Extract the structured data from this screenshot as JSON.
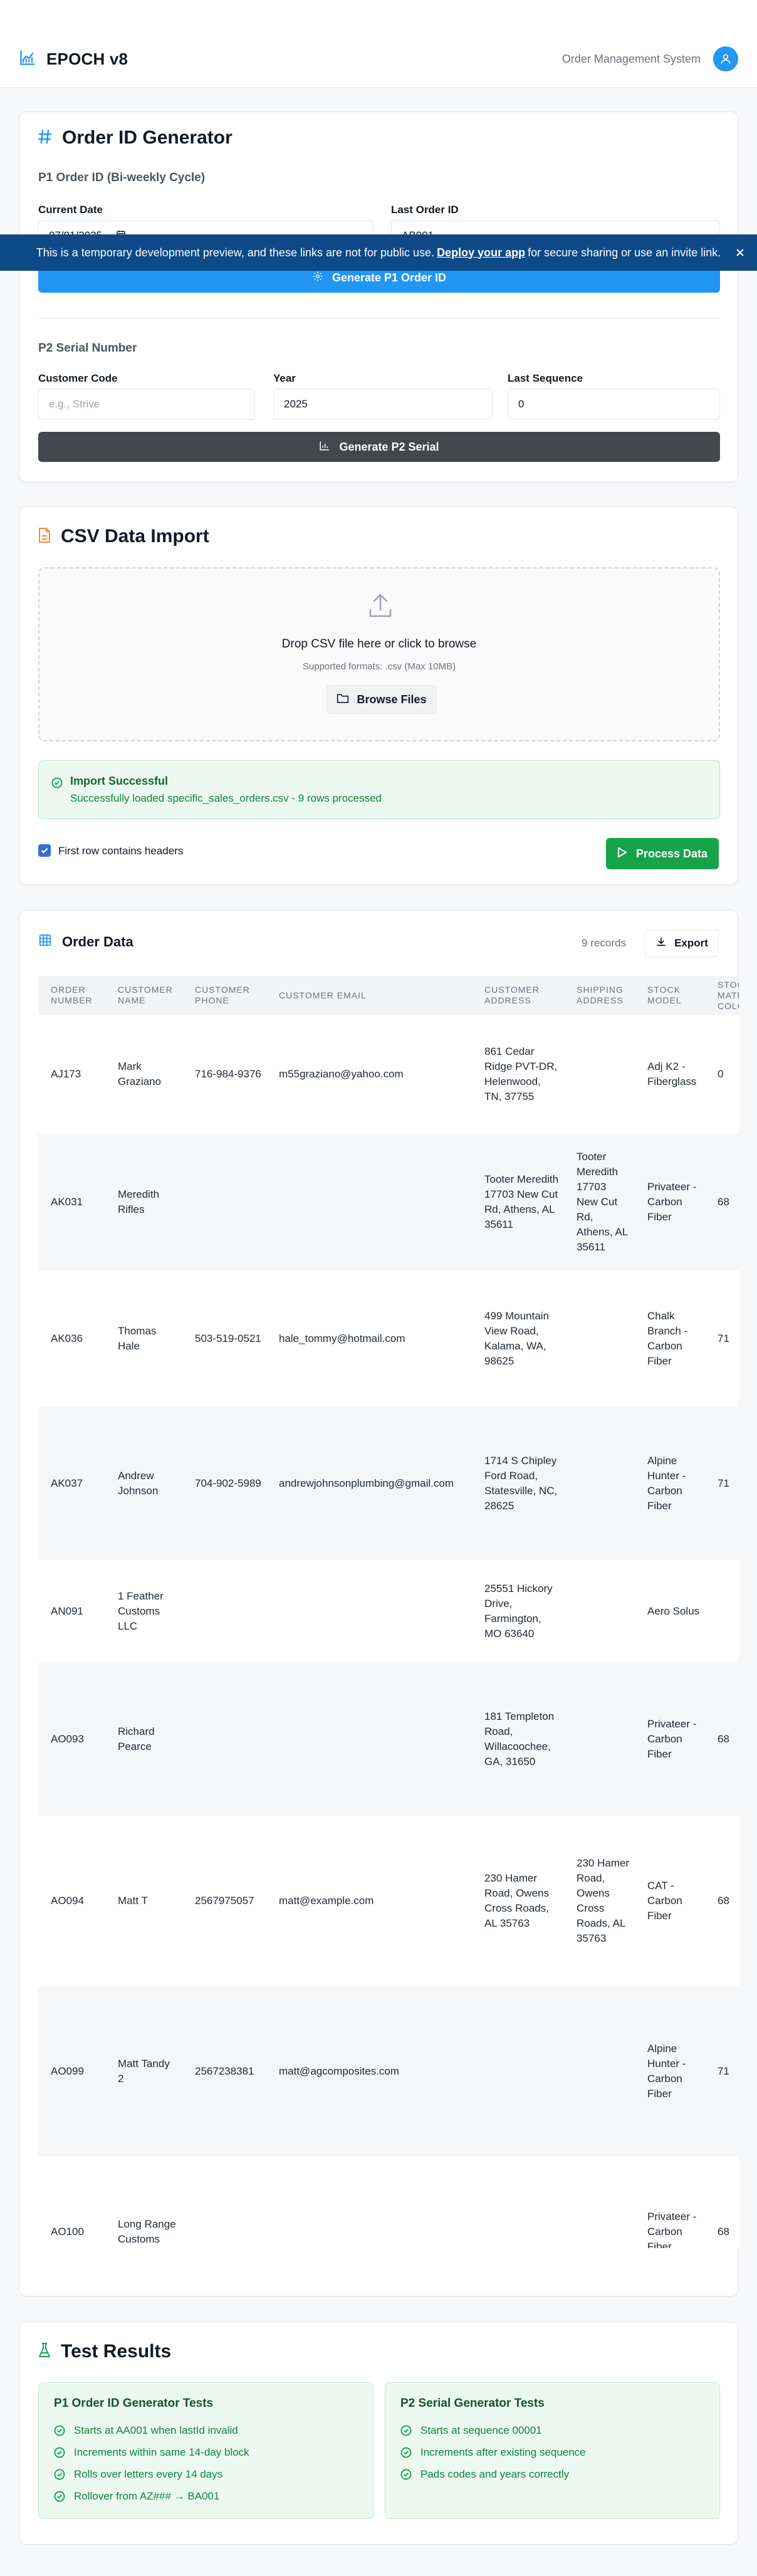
{
  "header": {
    "app_name": "EPOCH v8",
    "subtitle": "Order Management System"
  },
  "banner": {
    "text_before": "This is a temporary development preview, and these links are not for public use.",
    "link": "Deploy your app",
    "text_after": "for secure sharing or use an invite link."
  },
  "order_id_generator": {
    "title": "Order ID Generator",
    "p1_heading": "P1 Order ID (Bi-weekly Cycle)",
    "current_date_label": "Current Date",
    "current_date_value": "07/01/2025",
    "last_order_label": "Last Order ID",
    "last_order_value": "AB001",
    "generate_p1_label": "Generate P1 Order ID",
    "p2_heading": "P2 Serial Number",
    "customer_code_label": "Customer Code",
    "customer_code_placeholder": "e.g., Strive",
    "year_label": "Year",
    "year_value": "2025",
    "last_sequence_label": "Last Sequence",
    "last_sequence_value": "0",
    "generate_p2_label": "Generate P2 Serial"
  },
  "csv_import": {
    "title": "CSV Data Import",
    "drop_title": "Drop CSV file here or click to browse",
    "drop_sub": "Supported formats: .csv (Max 10MB)",
    "browse_label": "Browse Files",
    "success_title": "Import Successful",
    "success_msg": "Successfully loaded specific_sales_orders.csv - 9 rows processed",
    "headers_checkbox_label": "First row contains headers",
    "headers_checked": true,
    "process_label": "Process Data"
  },
  "order_data": {
    "title": "Order Data",
    "record_count": "9 records",
    "export_label": "Export",
    "columns": [
      "ORDER NUMBER",
      "CUSTOMER NAME",
      "CUSTOMER PHONE",
      "CUSTOMER EMAIL",
      "CUSTOMER ADDRESS",
      "SHIPPING ADDRESS",
      "STOCK MODEL",
      "STOCK MATERIAL COLOR"
    ],
    "rows": [
      [
        "AJ173",
        "Mark Graziano",
        "716-984-9376",
        "m55graziano@yahoo.com",
        "861 Cedar Ridge PVT-DR, Helenwood, TN, 37755",
        "",
        "Adj K2 - Fiberglass",
        "0"
      ],
      [
        "AK031",
        "Meredith Rifles",
        "",
        "",
        "Tooter Meredith 17703 New Cut Rd, Athens, AL 35611",
        "Tooter Meredith 17703 New Cut Rd, Athens, AL 35611",
        "Privateer - Carbon Fiber",
        "68"
      ],
      [
        "AK036",
        "Thomas Hale",
        "503-519-0521",
        "hale_tommy@hotmail.com",
        "499 Mountain View Road, Kalama, WA, 98625",
        "",
        "Chalk Branch - Carbon Fiber",
        "71"
      ],
      [
        "AK037",
        "Andrew Johnson",
        "704-902-5989",
        "andrewjohnsonplumbing@gmail.com",
        "1714 S Chipley Ford Road, Statesville, NC, 28625",
        "",
        "Alpine Hunter - Carbon Fiber",
        "71"
      ],
      [
        "AN091",
        "1 Feather Customs LLC",
        "",
        "",
        "25551 Hickory Drive, Farmington, MO 63640",
        "",
        "Aero Solus",
        ""
      ],
      [
        "AO093",
        "Richard Pearce",
        "",
        "",
        "181 Templeton Road, Willacoochee, GA, 31650",
        "",
        "Privateer - Carbon Fiber",
        "68"
      ],
      [
        "AO094",
        "Matt T",
        "2567975057",
        "matt@example.com",
        "230 Hamer Road, Owens Cross Roads, AL 35763",
        "230 Hamer Road, Owens Cross Roads, AL 35763",
        "CAT - Carbon Fiber",
        "68"
      ],
      [
        "AO099",
        "Matt Tandy 2",
        "2567238381",
        "matt@agcomposites.com",
        "",
        "",
        "Alpine Hunter - Carbon Fiber",
        "71"
      ],
      [
        "AO100",
        "Long Range Customs",
        "",
        "",
        "",
        "",
        "Privateer - Carbon Fiber",
        "68"
      ]
    ]
  },
  "tests": {
    "title": "Test Results",
    "p1": {
      "title": "P1 Order ID Generator Tests",
      "items": [
        "Starts at AA001 when lastId invalid",
        "Increments within same 14-day block",
        "Rolls over letters every 14 days",
        "Rollover from AZ### → BA001"
      ]
    },
    "p2": {
      "title": "P2 Serial Generator Tests",
      "items": [
        "Starts at sequence 00001",
        "Increments after existing sequence",
        "Pads codes and years correctly"
      ]
    }
  },
  "colors": {
    "primary_blue": "#2196f3",
    "dark_button": "#45474e",
    "success_green": "#16a34a",
    "banner_blue": "#0d4a87",
    "csv_icon_orange": "#f08a3c"
  }
}
